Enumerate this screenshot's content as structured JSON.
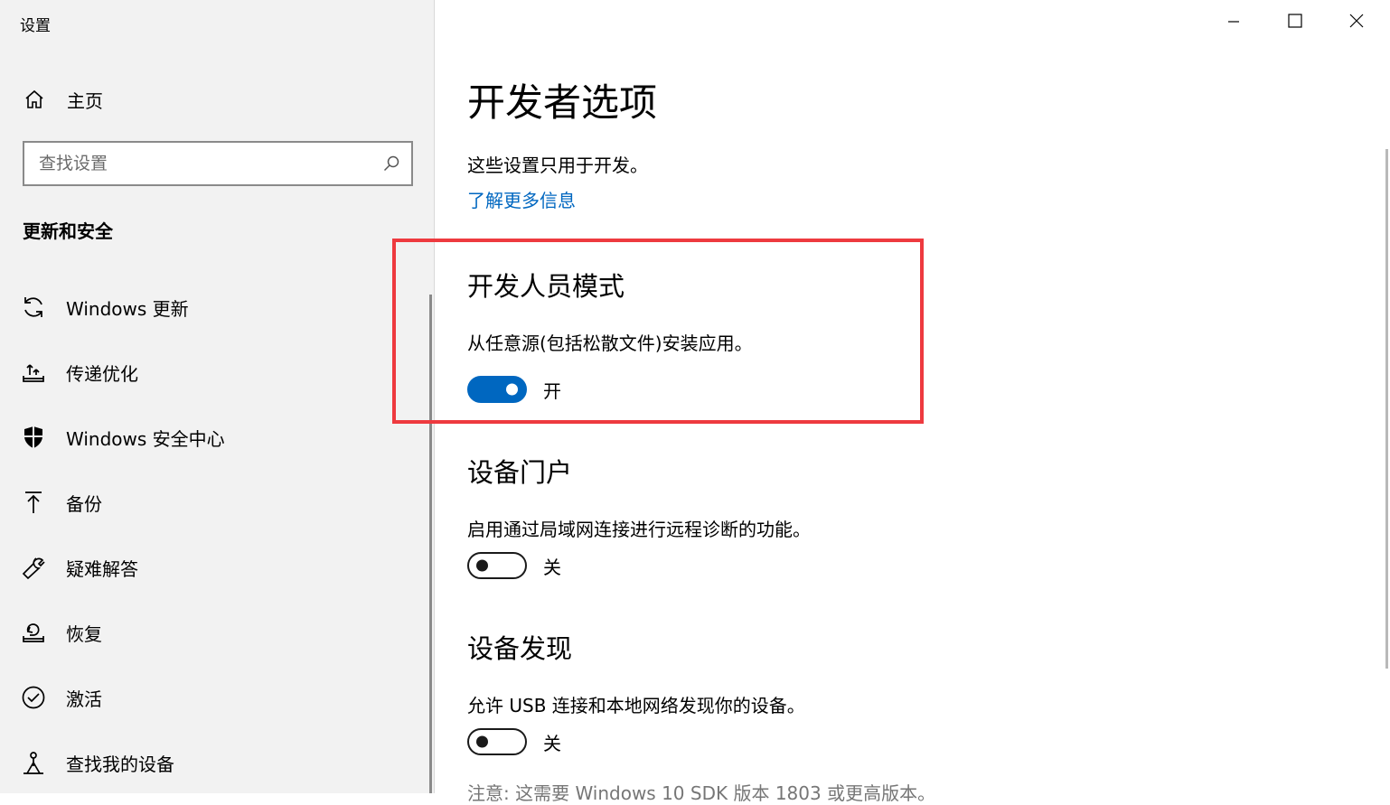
{
  "window": {
    "title": "设置",
    "minimize_icon": "minimize-icon",
    "maximize_icon": "maximize-icon",
    "close_icon": "close-icon"
  },
  "sidebar": {
    "home": {
      "label": "主页",
      "icon": "home-icon"
    },
    "search": {
      "placeholder": "查找设置",
      "icon": "search-icon"
    },
    "section_title": "更新和安全",
    "items": [
      {
        "label": "Windows 更新",
        "icon": "sync-icon"
      },
      {
        "label": "传递优化",
        "icon": "delivery-optimization-icon"
      },
      {
        "label": "Windows 安全中心",
        "icon": "shield-icon"
      },
      {
        "label": "备份",
        "icon": "backup-arrow-icon"
      },
      {
        "label": "疑难解答",
        "icon": "wrench-icon"
      },
      {
        "label": "恢复",
        "icon": "recovery-icon"
      },
      {
        "label": "激活",
        "icon": "checkmark-circle-icon"
      },
      {
        "label": "查找我的设备",
        "icon": "find-device-icon"
      }
    ]
  },
  "main": {
    "title": "开发者选项",
    "description": "这些设置只用于开发。",
    "learn_more": "了解更多信息",
    "developer_mode": {
      "heading": "开发人员模式",
      "description": "从任意源(包括松散文件)安装应用。",
      "toggle_state": "on",
      "toggle_label": "开"
    },
    "device_portal": {
      "heading": "设备门户",
      "description": "启用通过局域网连接进行远程诊断的功能。",
      "toggle_state": "off",
      "toggle_label": "关"
    },
    "device_discovery": {
      "heading": "设备发现",
      "description": "允许 USB 连接和本地网络发现你的设备。",
      "toggle_state": "off",
      "toggle_label": "关"
    },
    "note": "注意: 这需要 Windows 10 SDK 版本 1803 或更高版本。"
  },
  "colors": {
    "accent": "#0067c0",
    "highlight_border": "#ee3a3f",
    "sidebar_bg": "#f2f2f2"
  }
}
